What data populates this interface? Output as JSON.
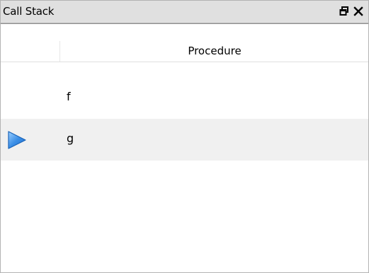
{
  "window": {
    "title": "Call Stack",
    "float_icon": "restore-window-icon",
    "close_icon": "close-icon"
  },
  "table": {
    "columns": [
      {
        "label": ""
      },
      {
        "label": "Procedure"
      }
    ],
    "rows": [
      {
        "procedure": "f",
        "current": false
      },
      {
        "procedure": "g",
        "current": true,
        "indicator_icon": "current-frame-arrow-icon"
      }
    ]
  },
  "colors": {
    "titlebar_bg": "#e0e0e0",
    "selected_row_bg": "#f0f0f0",
    "arrow_fill": "#3a8ee6"
  }
}
